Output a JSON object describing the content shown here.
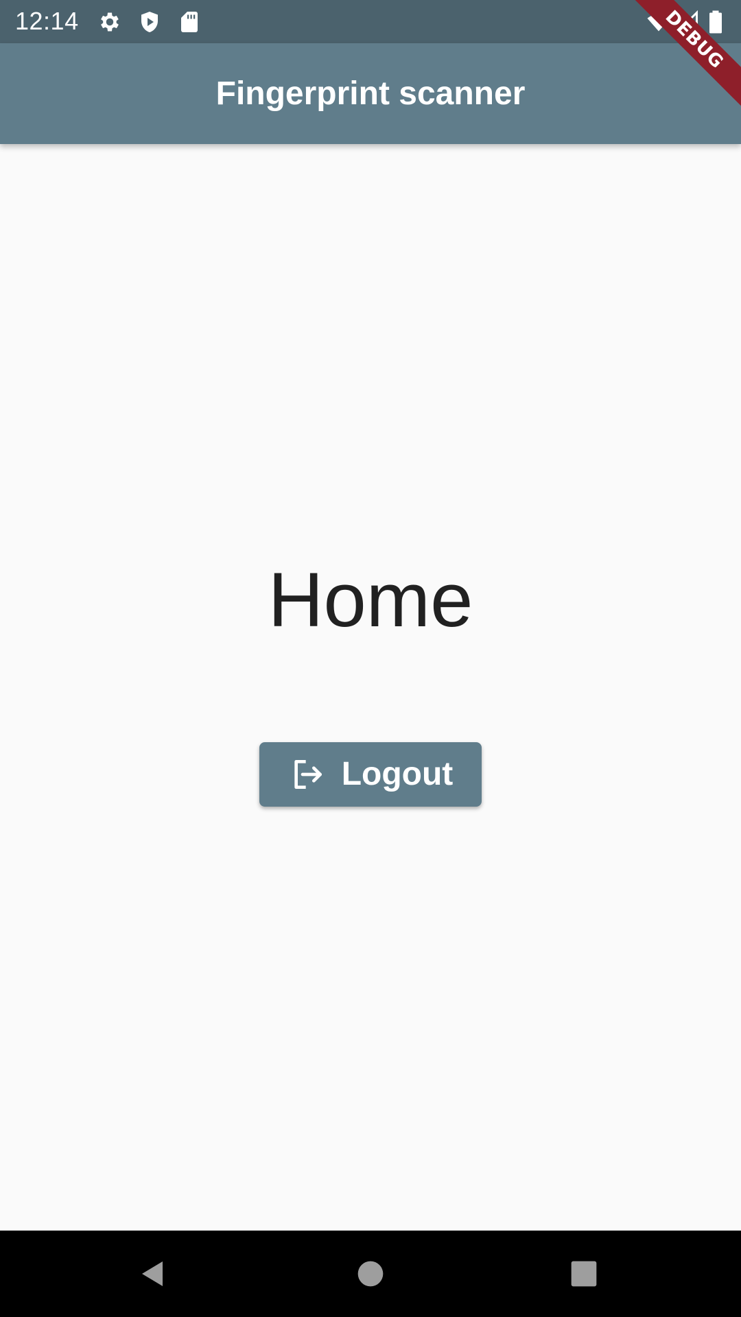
{
  "status_bar": {
    "time": "12:14",
    "icons": [
      "gear-icon",
      "shield-play-icon",
      "sd-card-icon",
      "wifi-icon",
      "signal-icon",
      "battery-icon"
    ]
  },
  "debug_banner": {
    "label": "DEBUG",
    "color": "#8e1f2a"
  },
  "app_bar": {
    "title": "Fingerprint scanner",
    "color": "#607d8b"
  },
  "main": {
    "heading": "Home",
    "logout_button": {
      "label": "Logout",
      "icon": "logout-icon"
    }
  },
  "nav_bar": {
    "buttons": [
      "back-icon",
      "home-icon",
      "recents-icon"
    ]
  },
  "colors": {
    "status_bar": "#4b626d",
    "app_bar": "#607d8b",
    "background": "#fafafa",
    "text": "#212121"
  }
}
